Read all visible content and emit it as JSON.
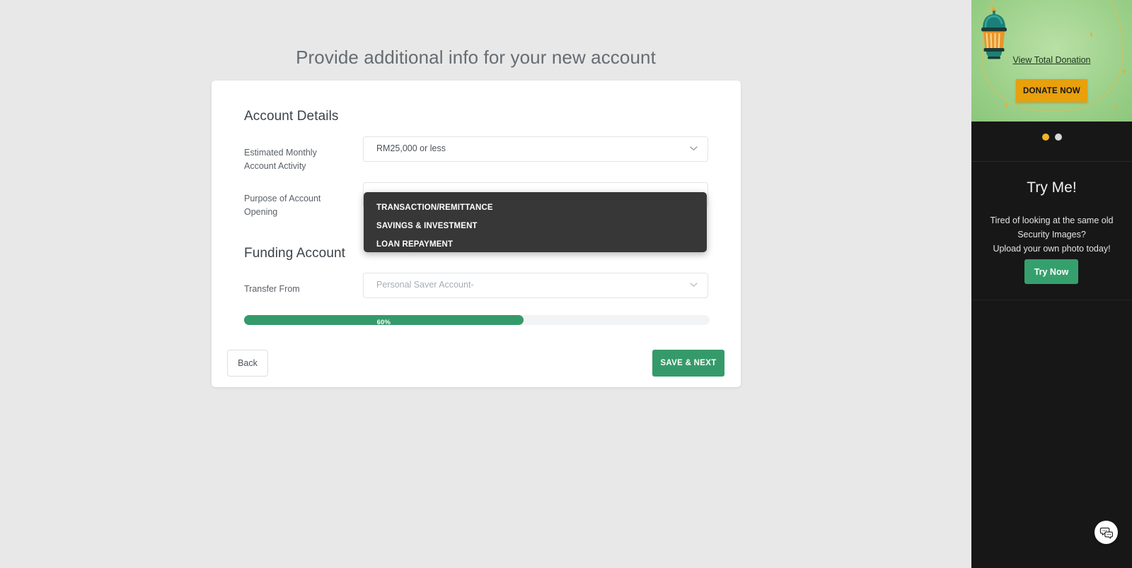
{
  "page": {
    "title": "Provide additional info for your new account",
    "background_color": "#e8e8e8"
  },
  "form": {
    "sections": {
      "account_details": "Account Details",
      "funding_account": "Funding Account"
    },
    "fields": [
      {
        "label": "Estimated Monthly Account Activity",
        "label_line1": "Estimated Monthly",
        "label_line2": "Account Activity",
        "value": "RM25,000 or less",
        "is_placeholder": false,
        "icon": "chevron-down-icon"
      },
      {
        "label": "Purpose of Account Opening",
        "label_line1": "Purpose of Account",
        "label_line2": "Opening",
        "value": "",
        "is_placeholder": true,
        "icon": "chevron-down-icon"
      },
      {
        "label": "Transfer From",
        "label_line1": "Transfer From",
        "label_line2": "",
        "value": "Personal Saver Account-",
        "is_placeholder": true,
        "icon": "chevron-down-icon"
      }
    ],
    "purpose_dropdown": {
      "open": true,
      "background_color": "#373737",
      "options": [
        "TRANSACTION/REMITTANCE",
        "SAVINGS & INVESTMENT",
        "LOAN REPAYMENT"
      ]
    },
    "progress": {
      "label": "60%",
      "percent": 60,
      "fill_color": "#359a6a",
      "track_color": "#f2f3f4"
    },
    "buttons": {
      "back": "Back",
      "save_next": "SAVE & NEXT",
      "save_next_color": "#359a6a"
    }
  },
  "right_panel": {
    "background_color": "#171717",
    "banner": {
      "background_color": "#9bd089",
      "lantern_icon": "lantern-icon",
      "view_link": "View Total Donation",
      "donate_button": "DONATE NOW",
      "donate_button_color": "#e8a00c"
    },
    "carousel": {
      "dots": [
        {
          "active": true,
          "color": "#f0b429"
        },
        {
          "active": false,
          "color": "#d8d8d8"
        }
      ]
    },
    "try_me": {
      "title": "Try Me!",
      "line1": "Tired of looking at the same old",
      "line2": "Security Images?",
      "line3": "Upload your own photo today!",
      "button": "Try Now",
      "button_color": "#35a06d"
    },
    "chat": {
      "icon": "chat-bubble-icon"
    }
  }
}
